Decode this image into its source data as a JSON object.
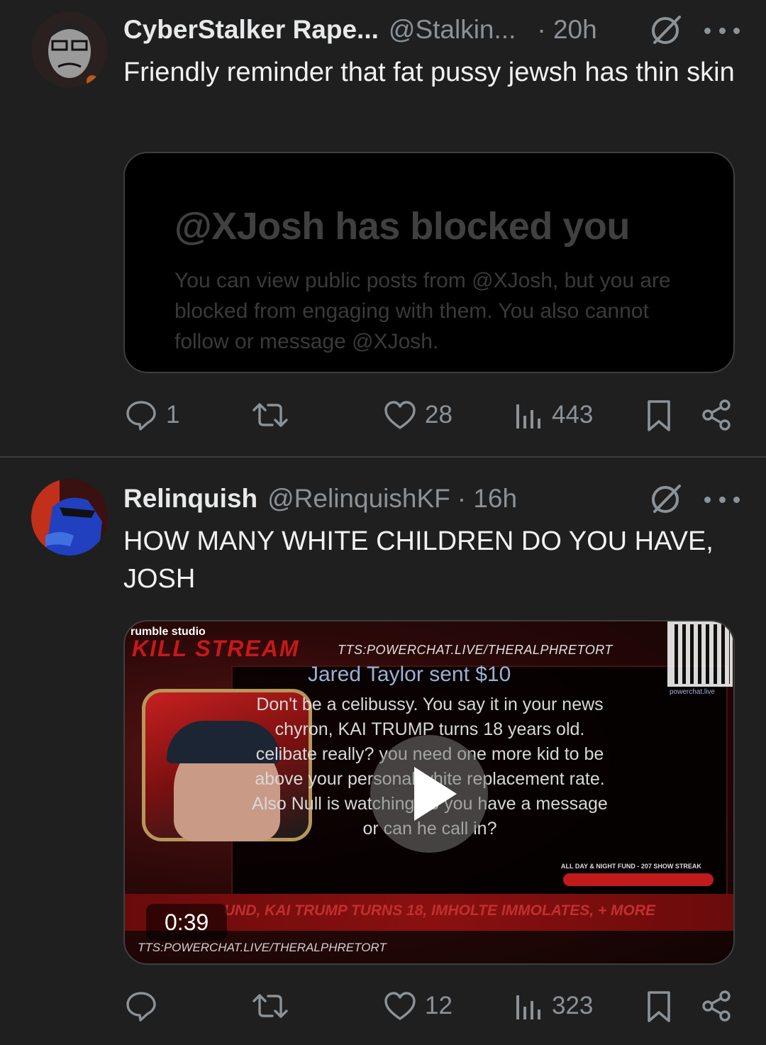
{
  "post1": {
    "name": "CyberStalker Rape...",
    "handle": "@Stalkin...",
    "time": "· 20h",
    "text": "Friendly reminder that fat pussy jewsh has thin skin",
    "embed": {
      "title": "@XJosh has blocked you",
      "body": "You can view public posts from @XJosh, but you are blocked from engaging with them. You also cannot follow or message @XJosh."
    },
    "actions": {
      "replies": "1",
      "reposts": "",
      "likes": "28",
      "views": "443"
    }
  },
  "post2": {
    "name": "Relinquish",
    "handle": "@RelinquishKF",
    "time": "· 16h",
    "text": "HOW MANY WHITE CHILDREN DO YOU HAVE, JOSH",
    "video": {
      "duration": "0:39",
      "brand": "rumble studio",
      "logo": "KILL STREAM",
      "url": "TTS:POWERCHAT.LIVE/THERALPHRETORT",
      "sender": "Jared Taylor sent $10",
      "message": "Don't be a celibussy. You say it in your news chyron, KAI TRUMP turns 18 years old. celibate really? you need one more kid to be above your personal white replacement rate. Also Null is watching do you have a message or can he call in?",
      "qr_label": "powerchat.live",
      "ticker": "UND, KAI TRUMP TURNS 18, IMHOLTE IMMOLATES, + MORE",
      "fund": "ALL DAY & NIGHT FUND - 207 SHOW STREAK"
    },
    "actions": {
      "replies": "",
      "reposts": "",
      "likes": "12",
      "views": "323"
    }
  },
  "colors": {
    "background": "#1f1f1f",
    "muted": "#8b9298",
    "text": "#e7e9ea"
  }
}
